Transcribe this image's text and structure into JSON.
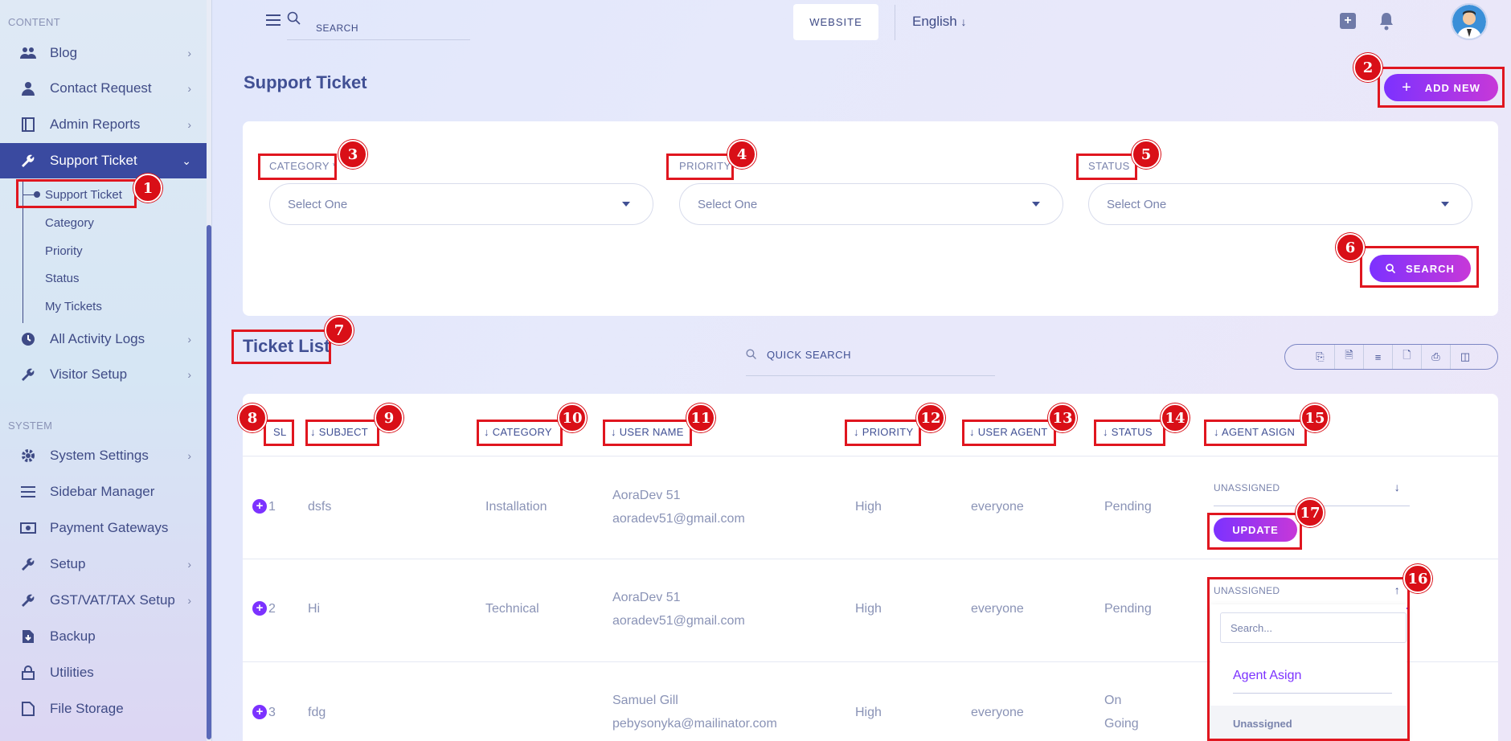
{
  "sidebar": {
    "content_label": "CONTENT",
    "system_label": "SYSTEM",
    "items": [
      {
        "label": "Blog",
        "icon": "users-icon"
      },
      {
        "label": "Contact Request",
        "icon": "user-icon"
      },
      {
        "label": "Admin Reports",
        "icon": "report-icon"
      },
      {
        "label": "Support Ticket",
        "icon": "wrench-icon"
      },
      {
        "label": "All Activity Logs",
        "icon": "clock-icon"
      },
      {
        "label": "Visitor Setup",
        "icon": "wrench-icon"
      },
      {
        "label": "System Settings",
        "icon": "gear-icon"
      },
      {
        "label": "Sidebar Manager",
        "icon": "bars-icon"
      },
      {
        "label": "Payment Gateways",
        "icon": "money-icon"
      },
      {
        "label": "Setup",
        "icon": "wrench-icon"
      },
      {
        "label": "GST/VAT/TAX Setup",
        "icon": "wrench-icon"
      },
      {
        "label": "Backup",
        "icon": "file-download-icon"
      },
      {
        "label": "Utilities",
        "icon": "lock-icon"
      },
      {
        "label": "File Storage",
        "icon": "file-icon"
      }
    ],
    "sub_items": [
      "Support Ticket",
      "Category",
      "Priority",
      "Status",
      "My Tickets"
    ]
  },
  "topbar": {
    "search_placeholder": "SEARCH",
    "website_label": "WEBSITE",
    "language": "English"
  },
  "page": {
    "title": "Support Ticket",
    "add_new_label": "ADD NEW"
  },
  "filters": {
    "category_label": "CATEGORY *",
    "priority_label": "PRIORITY",
    "status_label": "STATUS",
    "category_value": "Select One",
    "priority_value": "Select One",
    "status_value": "Select One",
    "search_label": "SEARCH"
  },
  "list": {
    "title": "Ticket List",
    "quick_search": "QUICK SEARCH",
    "columns": [
      "SL",
      "SUBJECT",
      "CATEGORY",
      "USER NAME",
      "PRIORITY",
      "USER AGENT",
      "STATUS",
      "AGENT ASIGN"
    ],
    "rows": [
      {
        "sl": "1",
        "subject": "dsfs",
        "category": "Installation",
        "user_name": "AoraDev 51",
        "user_email": "aoradev51@gmail.com",
        "priority": "High",
        "user_agent": "everyone",
        "status": "Pending",
        "status2": "",
        "assign": "UNASSIGNED"
      },
      {
        "sl": "2",
        "subject": "Hi",
        "category": "Technical",
        "user_name": "AoraDev 51",
        "user_email": "aoradev51@gmail.com",
        "priority": "High",
        "user_agent": "everyone",
        "status": "Pending",
        "status2": "",
        "assign": "UNASSIGNED"
      },
      {
        "sl": "3",
        "subject": "fdg",
        "category": "",
        "user_name": "Samuel Gill",
        "user_email": "pebysonyka@mailinator.com",
        "priority": "High",
        "user_agent": "everyone",
        "status": "On",
        "status2": "Going",
        "assign": ""
      }
    ],
    "update_label": "UPDATE",
    "dropdown": {
      "search_placeholder": "Search...",
      "option_1": "Agent Asign",
      "option_2": "Unassigned"
    }
  },
  "annotations": [
    "1",
    "2",
    "3",
    "4",
    "5",
    "6",
    "7",
    "8",
    "9",
    "10",
    "11",
    "12",
    "13",
    "14",
    "15",
    "16",
    "17"
  ],
  "colors": {
    "accent": "#7c32ff",
    "sidebar_active": "#3a4aa0",
    "annotation": "#e0161f"
  }
}
